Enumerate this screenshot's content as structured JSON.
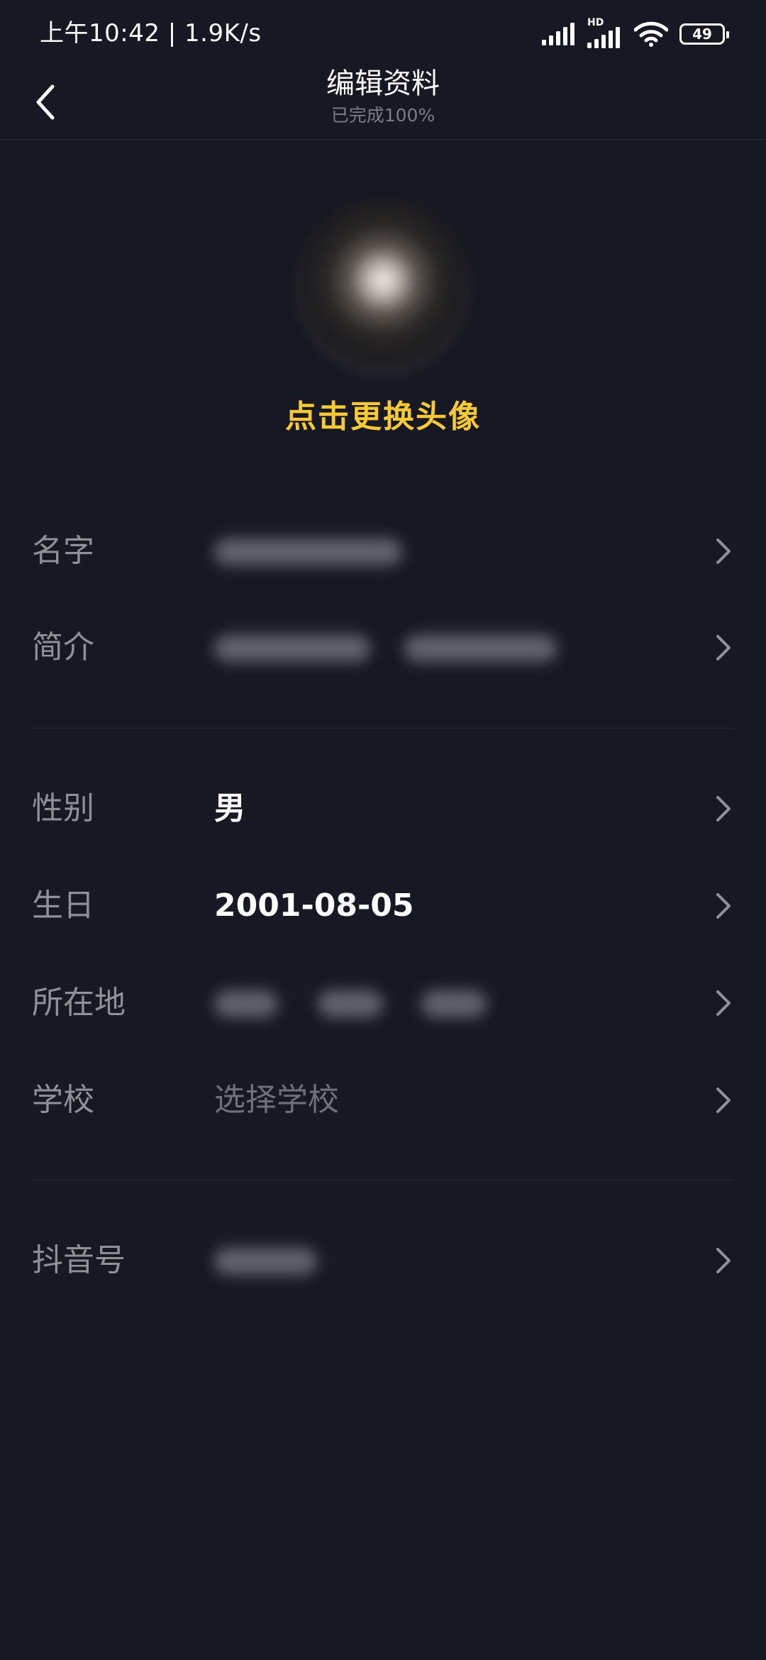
{
  "status_bar": {
    "time_speed": "上午10:42 | 1.9K/s",
    "signal_label": "HD",
    "battery": "49"
  },
  "header": {
    "title": "编辑资料",
    "subtitle": "已完成100%"
  },
  "avatar": {
    "hint": "点击更换头像"
  },
  "rows": {
    "name": {
      "label": "名字"
    },
    "bio": {
      "label": "简介"
    },
    "gender": {
      "label": "性别",
      "value": "男"
    },
    "birthday": {
      "label": "生日",
      "value": "2001-08-05"
    },
    "location": {
      "label": "所在地"
    },
    "school": {
      "label": "学校",
      "placeholder": "选择学校"
    },
    "douyin_id": {
      "label": "抖音号"
    }
  },
  "colors": {
    "background": "#161823",
    "accent": "#f9c933",
    "label": "#8f9098",
    "divider": "#262834"
  },
  "icons": [
    "back-arrow-icon",
    "signal-icon",
    "hd-signal-icon",
    "wifi-icon",
    "battery-icon",
    "chevron-right-icon"
  ]
}
